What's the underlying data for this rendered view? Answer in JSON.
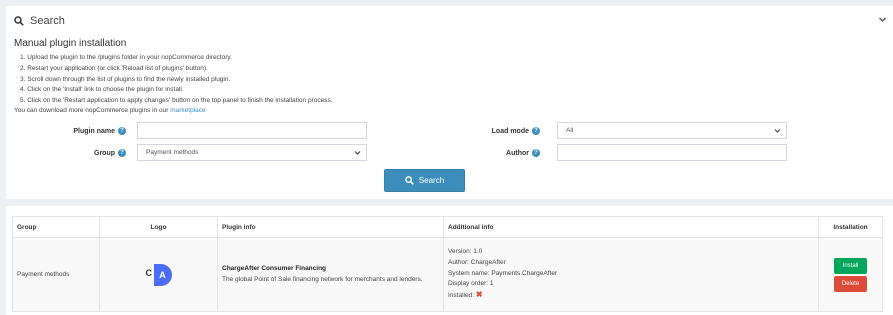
{
  "search_panel": {
    "title": "Search",
    "search_icon": "search-icon",
    "collapse_icon": "chevron-down-icon",
    "manual_title": "Manual plugin installation",
    "steps": [
      "1. Upload the plugin to the /plugins folder in your nopCommerce directory.",
      "2. Restart your application (or click 'Reload list of plugins' button).",
      "3. Scroll down through the list of plugins to find the newly installed plugin.",
      "4. Click on the 'Install' link to choose the plugin for install.",
      "5. Click on the 'Restart application to apply changes' button on the top panel to finish the installation process."
    ],
    "download_text": "You can download more nopCommerce plugins in our",
    "download_link": "marketplace"
  },
  "form": {
    "plugin_name_label": "Plugin name",
    "plugin_name_value": "",
    "group_label": "Group",
    "group_value": "Payment methods",
    "load_mode_label": "Load mode",
    "load_mode_value": "All",
    "author_label": "Author",
    "author_value": "",
    "help_icon": "?",
    "search_button": "Search"
  },
  "table": {
    "headers": [
      "Group",
      "Logo",
      "Plugin info",
      "Additional info",
      "Installation"
    ],
    "rows": [
      {
        "group": "Payment methods",
        "logo_text_left": "C",
        "logo_text_right": "A",
        "plugin_name": "ChargeAfter Consumer Financing",
        "plugin_description": "The global Point of Sale financing network for merchants and lenders.",
        "version": "Version: 1.0",
        "author": "Author: ChargeAfter",
        "system_name": "System name: Payments.ChargeAfter",
        "display_order": "Display order: 1",
        "installed_label": "Installed:",
        "installed_mark": "✖",
        "install_button": "Install",
        "delete_button": "Delete"
      }
    ]
  },
  "colors": {
    "primary": "#3c8dbc",
    "success": "#00a65a",
    "danger": "#dd4b39",
    "background": "#ecf0f5"
  }
}
